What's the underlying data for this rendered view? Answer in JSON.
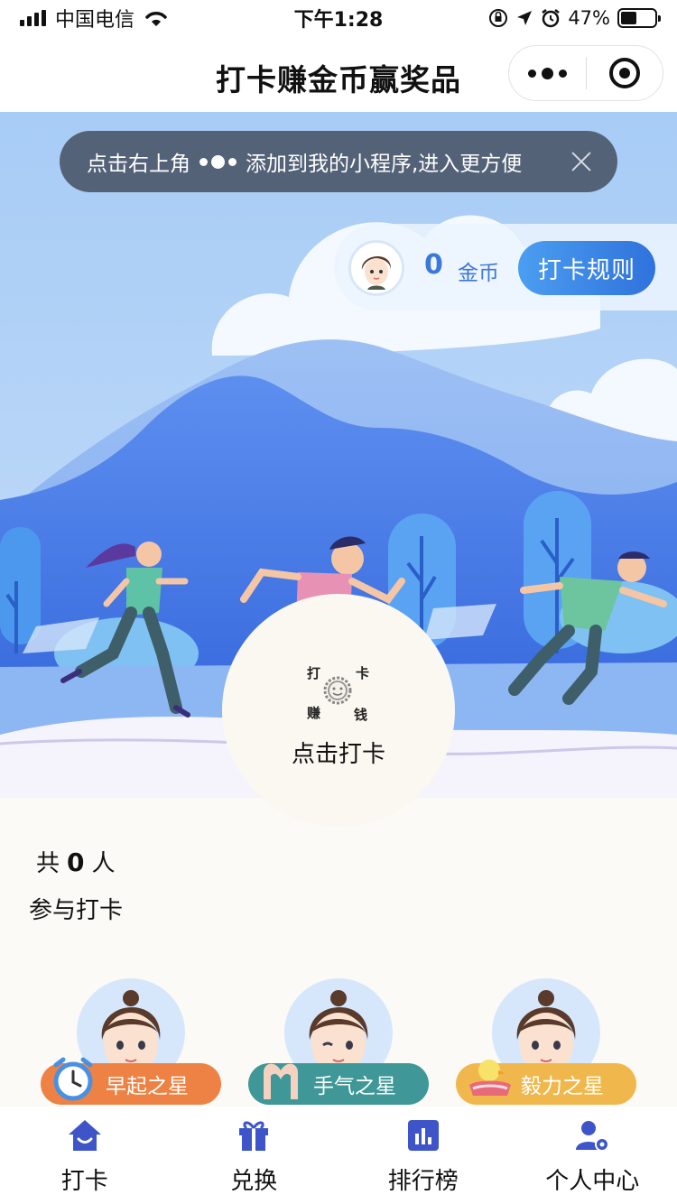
{
  "status_bar": {
    "carrier": "中国电信",
    "time": "下午1:28",
    "battery_percent": "47%",
    "battery_level": 0.47
  },
  "nav": {
    "title": "打卡赚金币赢奖品"
  },
  "tip_banner": {
    "text_before": "点击右上角",
    "text_after": "添加到我的小程序,进入更方便"
  },
  "coins": {
    "value": "0",
    "unit": "金币",
    "rules_label": "打卡规则"
  },
  "checkin": {
    "emblem_chars": [
      "打",
      "卡",
      "赚",
      "钱"
    ],
    "label": "点击打卡"
  },
  "stats": {
    "prefix": "共",
    "count": "0",
    "suffix": "人",
    "line2": "参与打卡"
  },
  "stars": [
    {
      "label": "早起之星",
      "color": "#ee8244",
      "icon": "alarm-clock-icon"
    },
    {
      "label": "手气之星",
      "color": "#3f9797",
      "icon": "heart-hands-icon"
    },
    {
      "label": "毅力之星",
      "color": "#f0b84c",
      "icon": "duckling-icon"
    }
  ],
  "tabs": [
    {
      "label": "打卡",
      "icon": "home-smile-icon"
    },
    {
      "label": "兑换",
      "icon": "gift-icon"
    },
    {
      "label": "排行榜",
      "icon": "bar-chart-icon"
    },
    {
      "label": "个人中心",
      "icon": "user-settings-icon"
    }
  ],
  "colors": {
    "accent_blue": "#3c78d8",
    "icon_blue": "#3d55c8",
    "hero_sky": "#a9cdf5",
    "hero_mountain": "#3f74e4"
  }
}
